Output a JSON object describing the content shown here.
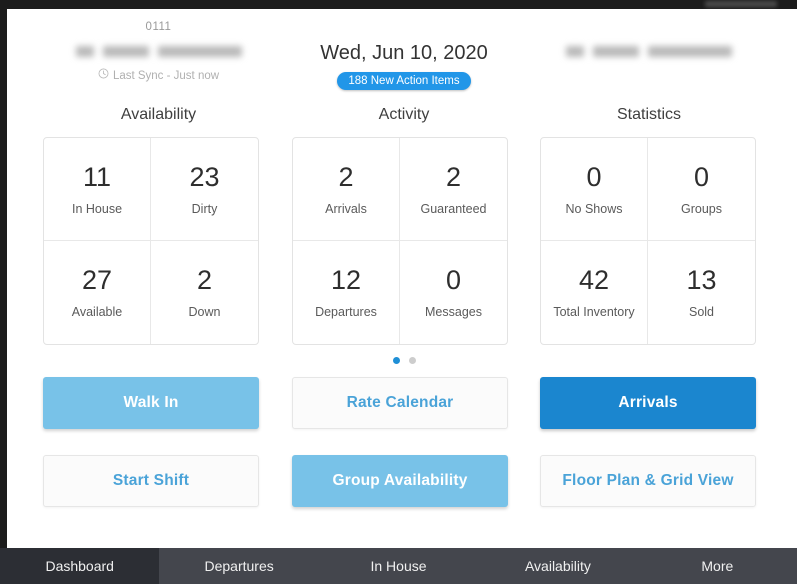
{
  "window": {
    "top_code": "0111"
  },
  "header": {
    "left": {
      "property_name_redacted": "",
      "sync_icon": "clock-icon",
      "sync_text": "Last Sync - Just now",
      "section_title": "Availability"
    },
    "center": {
      "date": "Wed, Jun 10, 2020",
      "badge": "188 New Action Items",
      "badge_color": "#2196e8",
      "section_title": "Activity"
    },
    "right": {
      "property_name_redacted": "",
      "section_title": "Statistics"
    }
  },
  "metrics": {
    "availability": [
      {
        "value": "11",
        "label": "In House"
      },
      {
        "value": "23",
        "label": "Dirty"
      },
      {
        "value": "27",
        "label": "Available"
      },
      {
        "value": "2",
        "label": "Down"
      }
    ],
    "activity": [
      {
        "value": "2",
        "label": "Arrivals"
      },
      {
        "value": "2",
        "label": "Guaranteed"
      },
      {
        "value": "12",
        "label": "Departures"
      },
      {
        "value": "0",
        "label": "Messages"
      }
    ],
    "statistics": [
      {
        "value": "0",
        "label": "No Shows"
      },
      {
        "value": "0",
        "label": "Groups"
      },
      {
        "value": "42",
        "label": "Total Inventory"
      },
      {
        "value": "13",
        "label": "Sold"
      }
    ]
  },
  "pager": {
    "total": 2,
    "active_index": 0
  },
  "actions": {
    "walk_in": "Walk In",
    "rate_calendar": "Rate Calendar",
    "arrivals": "Arrivals",
    "start_shift": "Start Shift",
    "group_availability": "Group Availability",
    "floor_plan": "Floor Plan & Grid View"
  },
  "colors": {
    "accent_light": "#78c2e8",
    "accent_dark": "#1b86cf",
    "ghost_text": "#4aa3d8",
    "nav_bar": "#44464d",
    "nav_active": "#2c2e34"
  },
  "bottom_nav": {
    "items": [
      {
        "label": "Dashboard",
        "active": true
      },
      {
        "label": "Departures",
        "active": false
      },
      {
        "label": "In House",
        "active": false
      },
      {
        "label": "Availability",
        "active": false
      },
      {
        "label": "More",
        "active": false
      }
    ]
  }
}
